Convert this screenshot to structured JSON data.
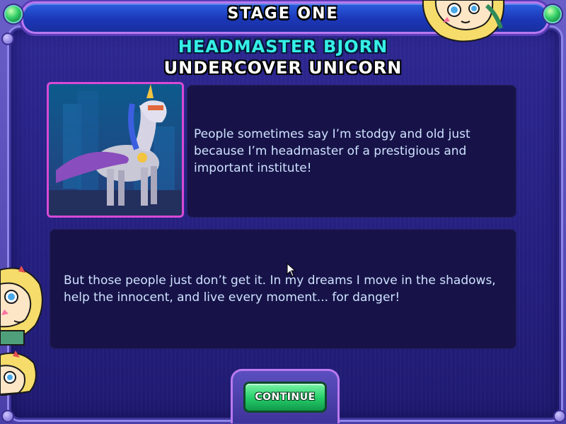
{
  "stage": {
    "title": "STAGE ONE"
  },
  "character": {
    "name": "HEADMASTER BJORN",
    "title": "UNDERCOVER UNICORN",
    "portrait_icon": "unicorn-portrait"
  },
  "dialog": {
    "line_1": "People sometimes say I’m stodgy and old just because I’m headmaster of a prestigious and important institute!",
    "line_2": "But those people just don’t get it. In my dreams I move in the shadows, help the innocent, and live every moment... for danger!"
  },
  "buttons": {
    "continue_label": "CONTINUE"
  },
  "colors": {
    "title_bar": "#1b37b8",
    "name_accent": "#35f0e6",
    "panel": "#241f7e",
    "text_box": "#171348",
    "dialog_text": "#cfe2ff",
    "button": "#28d06c",
    "portrait_border": "#d84ad6"
  },
  "decorations": [
    "star-butterfly-mascot-top-right",
    "star-butterfly-mascot-left",
    "star-butterfly-mascot-bottom-left"
  ]
}
